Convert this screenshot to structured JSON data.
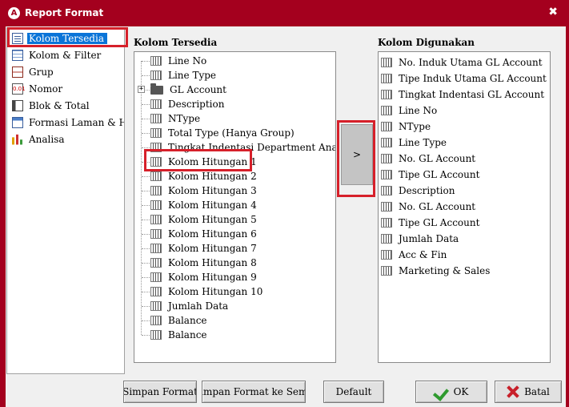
{
  "window": {
    "title": "Report Format",
    "close_glyph": "✖"
  },
  "nav": {
    "items": [
      {
        "label": "Kolom Tersedia",
        "icon": "document-list-icon",
        "selected": true
      },
      {
        "label": "Kolom & Filter",
        "icon": "grid-icon"
      },
      {
        "label": "Grup",
        "icon": "group-icon"
      },
      {
        "label": "Nomor",
        "icon": "numbering-icon",
        "glyph": "0.01"
      },
      {
        "label": "Blok & Total",
        "icon": "block-icon"
      },
      {
        "label": "Formasi Laman & Hur",
        "icon": "page-layout-icon"
      },
      {
        "label": "Analisa",
        "icon": "bar-chart-icon"
      }
    ]
  },
  "available": {
    "label": "Kolom Tersedia",
    "items": [
      {
        "text": "Line No"
      },
      {
        "text": "Line Type"
      },
      {
        "text": "GL Account",
        "folder": true,
        "expander": "+"
      },
      {
        "text": "Description"
      },
      {
        "text": "NType"
      },
      {
        "text": "Total Type (Hanya Group)"
      },
      {
        "text": "Tingkat Indentasi Department Anak"
      },
      {
        "text": "Kolom Hitungan 1"
      },
      {
        "text": "Kolom Hitungan 2"
      },
      {
        "text": "Kolom Hitungan 3"
      },
      {
        "text": "Kolom Hitungan 4"
      },
      {
        "text": "Kolom Hitungan 5"
      },
      {
        "text": "Kolom Hitungan 6"
      },
      {
        "text": "Kolom Hitungan 7"
      },
      {
        "text": "Kolom Hitungan 8"
      },
      {
        "text": "Kolom Hitungan 9"
      },
      {
        "text": "Kolom Hitungan 10"
      },
      {
        "text": "Jumlah Data"
      },
      {
        "text": "Balance"
      },
      {
        "text": "Balance"
      }
    ]
  },
  "used": {
    "label": "Kolom Digunakan",
    "items": [
      "No. Induk Utama GL Account",
      "Tipe Induk Utama GL Account",
      "Tingkat Indentasi GL Account",
      "Line No",
      "NType",
      "Line Type",
      "No. GL Account",
      "Tipe GL Account",
      "Description",
      "No. GL Account",
      "Tipe GL Account",
      "Jumlah Data",
      "Acc & Fin",
      "Marketing & Sales"
    ]
  },
  "move_button": {
    "label": ">"
  },
  "buttons": {
    "save_format": "Simpan Format",
    "save_format_all": "Simpan Format ke Semu",
    "default": "Default",
    "ok": "OK",
    "cancel": "Batal"
  }
}
